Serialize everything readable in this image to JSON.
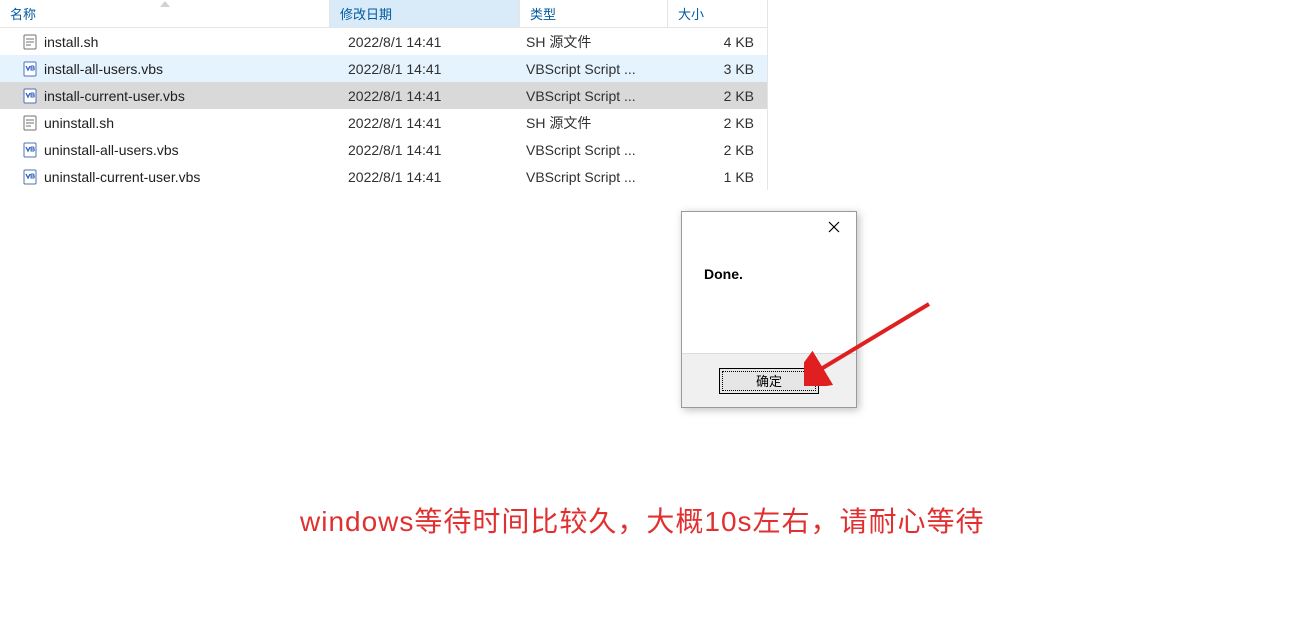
{
  "columns": {
    "name": "名称",
    "date": "修改日期",
    "type": "类型",
    "size": "大小"
  },
  "files": [
    {
      "icon": "sh",
      "name": "install.sh",
      "date": "2022/8/1 14:41",
      "type": "SH 源文件",
      "size": "4 KB",
      "state": ""
    },
    {
      "icon": "vbs",
      "name": "install-all-users.vbs",
      "date": "2022/8/1 14:41",
      "type": "VBScript Script ...",
      "size": "3 KB",
      "state": "hover"
    },
    {
      "icon": "vbs",
      "name": "install-current-user.vbs",
      "date": "2022/8/1 14:41",
      "type": "VBScript Script ...",
      "size": "2 KB",
      "state": "inactive-sel"
    },
    {
      "icon": "sh",
      "name": "uninstall.sh",
      "date": "2022/8/1 14:41",
      "type": "SH 源文件",
      "size": "2 KB",
      "state": ""
    },
    {
      "icon": "vbs",
      "name": "uninstall-all-users.vbs",
      "date": "2022/8/1 14:41",
      "type": "VBScript Script ...",
      "size": "2 KB",
      "state": ""
    },
    {
      "icon": "vbs",
      "name": "uninstall-current-user.vbs",
      "date": "2022/8/1 14:41",
      "type": "VBScript Script ...",
      "size": "1 KB",
      "state": ""
    }
  ],
  "dialog": {
    "message": "Done.",
    "ok_label": "确定"
  },
  "caption": "windows等待时间比较久，大概10s左右，请耐心等待"
}
